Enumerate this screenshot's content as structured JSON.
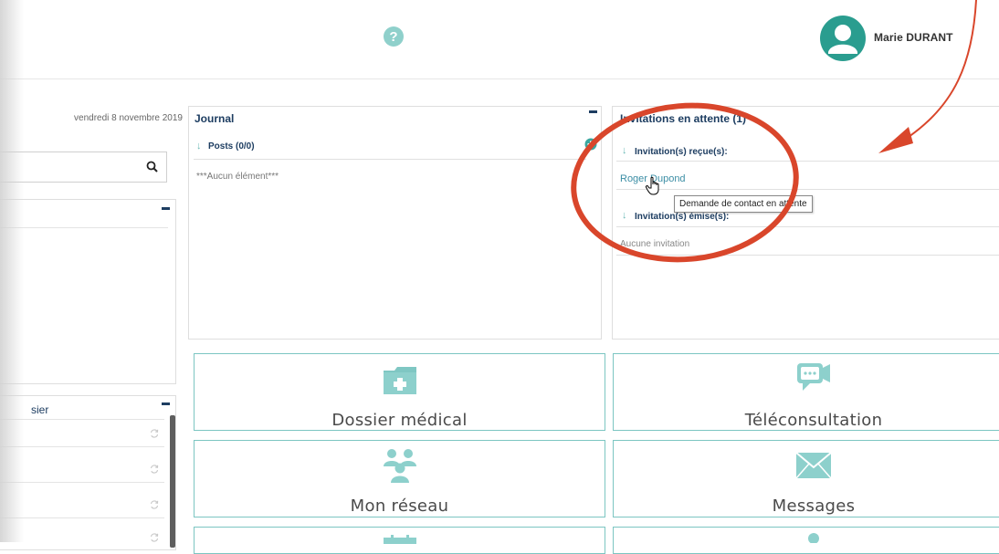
{
  "header": {
    "user_name": "Marie DURANT"
  },
  "sidebar": {
    "date": "vendredi 8 novembre 2019",
    "search_placeholder": "",
    "panel2_title": "sier"
  },
  "journal": {
    "title": "Journal",
    "posts_label": "Posts (0/0)",
    "empty": "***Aucun élément***"
  },
  "invitations": {
    "title": "Invitations en attente (1)",
    "received_label": "Invitation(s) reçue(s):",
    "received_items": [
      "Roger Dupond"
    ],
    "sent_label": "Invitation(s) émise(s):",
    "sent_empty": "Aucune invitation",
    "tooltip": "Demande de contact en attente"
  },
  "tiles": [
    {
      "label": "Dossier médical",
      "icon": "medical-folder-icon"
    },
    {
      "label": "Téléconsultation",
      "icon": "video-chat-icon"
    },
    {
      "label": "Mon réseau",
      "icon": "network-people-icon"
    },
    {
      "label": "Messages",
      "icon": "envelope-icon"
    }
  ],
  "colors": {
    "accent": "#6bb9b6",
    "tile_border": "#7cc6c2",
    "navy": "#1d3d61",
    "annotation_red": "#d9462b",
    "avatar": "#2a9d8f"
  }
}
